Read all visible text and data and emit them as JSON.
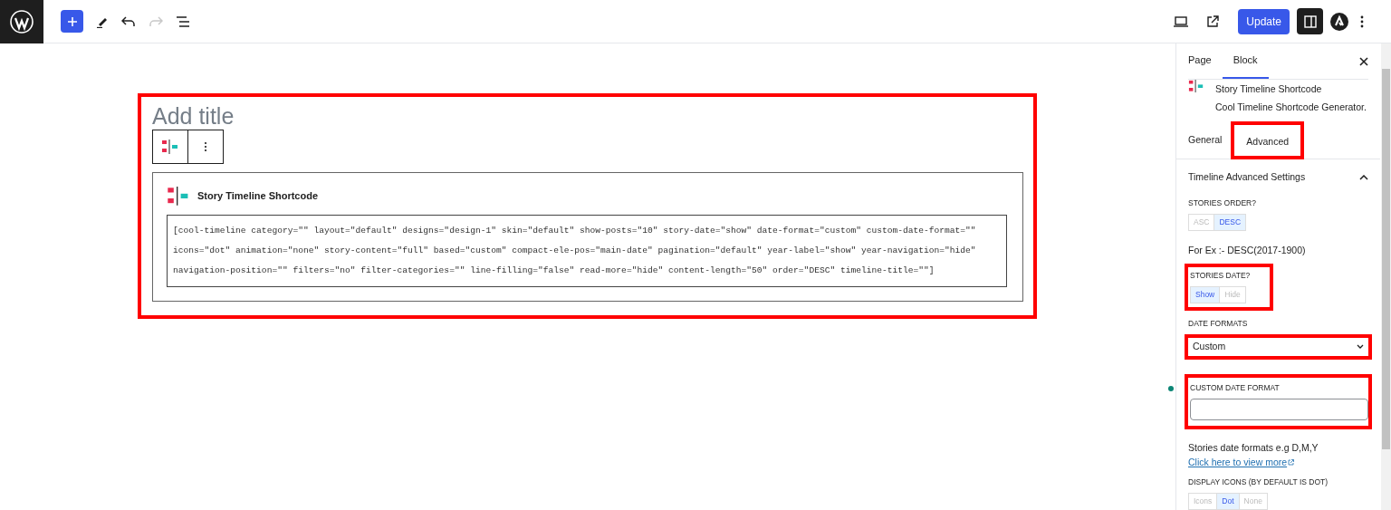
{
  "toolbar": {
    "update_label": "Update",
    "redo_disabled": true
  },
  "editor": {
    "title_placeholder": "Add title",
    "highlighted": true,
    "block": {
      "title": "Story Timeline Shortcode",
      "shortcode_lines": [
        "[cool-timeline category=\"\" layout=\"default\" designs=\"design-1\" skin=\"default\" show-posts=\"10\" story-date=\"show\" date-format=\"custom\" custom-date-format=\"\"",
        "icons=\"dot\" animation=\"none\" story-content=\"full\" based=\"custom\" compact-ele-pos=\"main-date\" pagination=\"default\" year-label=\"show\" year-navigation=\"hide\"",
        "navigation-position=\"\" filters=\"no\" filter-categories=\"\" line-filling=\"false\" read-more=\"hide\" content-length=\"50\" order=\"DESC\" timeline-title=\"\"]"
      ]
    }
  },
  "sidebar": {
    "tabs": [
      {
        "label": "Page",
        "selected": false
      },
      {
        "label": "Block",
        "selected": true
      }
    ],
    "block_card": {
      "title": "Story Timeline Shortcode",
      "description": "Cool Timeline Shortcode Generator."
    },
    "sub_tabs": [
      {
        "label": "General",
        "selected": false,
        "highlighted": false
      },
      {
        "label": "Advanced",
        "selected": true,
        "highlighted": true
      }
    ],
    "panel": {
      "title": "Timeline Advanced Settings",
      "expanded": true,
      "fields": [
        {
          "kind": "toggle",
          "label": "STORIES ORDER?",
          "highlighted": false,
          "options": [
            {
              "label": "ASC",
              "selected": false
            },
            {
              "label": "DESC",
              "selected": true
            }
          ],
          "help": "For Ex :- DESC(2017-1900)"
        },
        {
          "kind": "toggle",
          "label": "STORIES DATE?",
          "highlighted": true,
          "options": [
            {
              "label": "Show",
              "selected": true
            },
            {
              "label": "Hide",
              "selected": false
            }
          ]
        },
        {
          "kind": "select",
          "label": "DATE FORMATS",
          "highlighted": true,
          "value": "Custom"
        },
        {
          "kind": "text",
          "label": "CUSTOM DATE FORMAT",
          "highlighted": true,
          "help": "Stories date formats e.g D,M,Y",
          "link": "Click here to view more"
        },
        {
          "kind": "toggle",
          "label": "DISPLAY ICONS (BY DEFAULT IS DOT)",
          "highlighted": false,
          "options": [
            {
              "label": "Icons",
              "selected": false
            },
            {
              "label": "Dot",
              "selected": true
            },
            {
              "label": "None",
              "selected": false
            }
          ]
        }
      ]
    }
  }
}
